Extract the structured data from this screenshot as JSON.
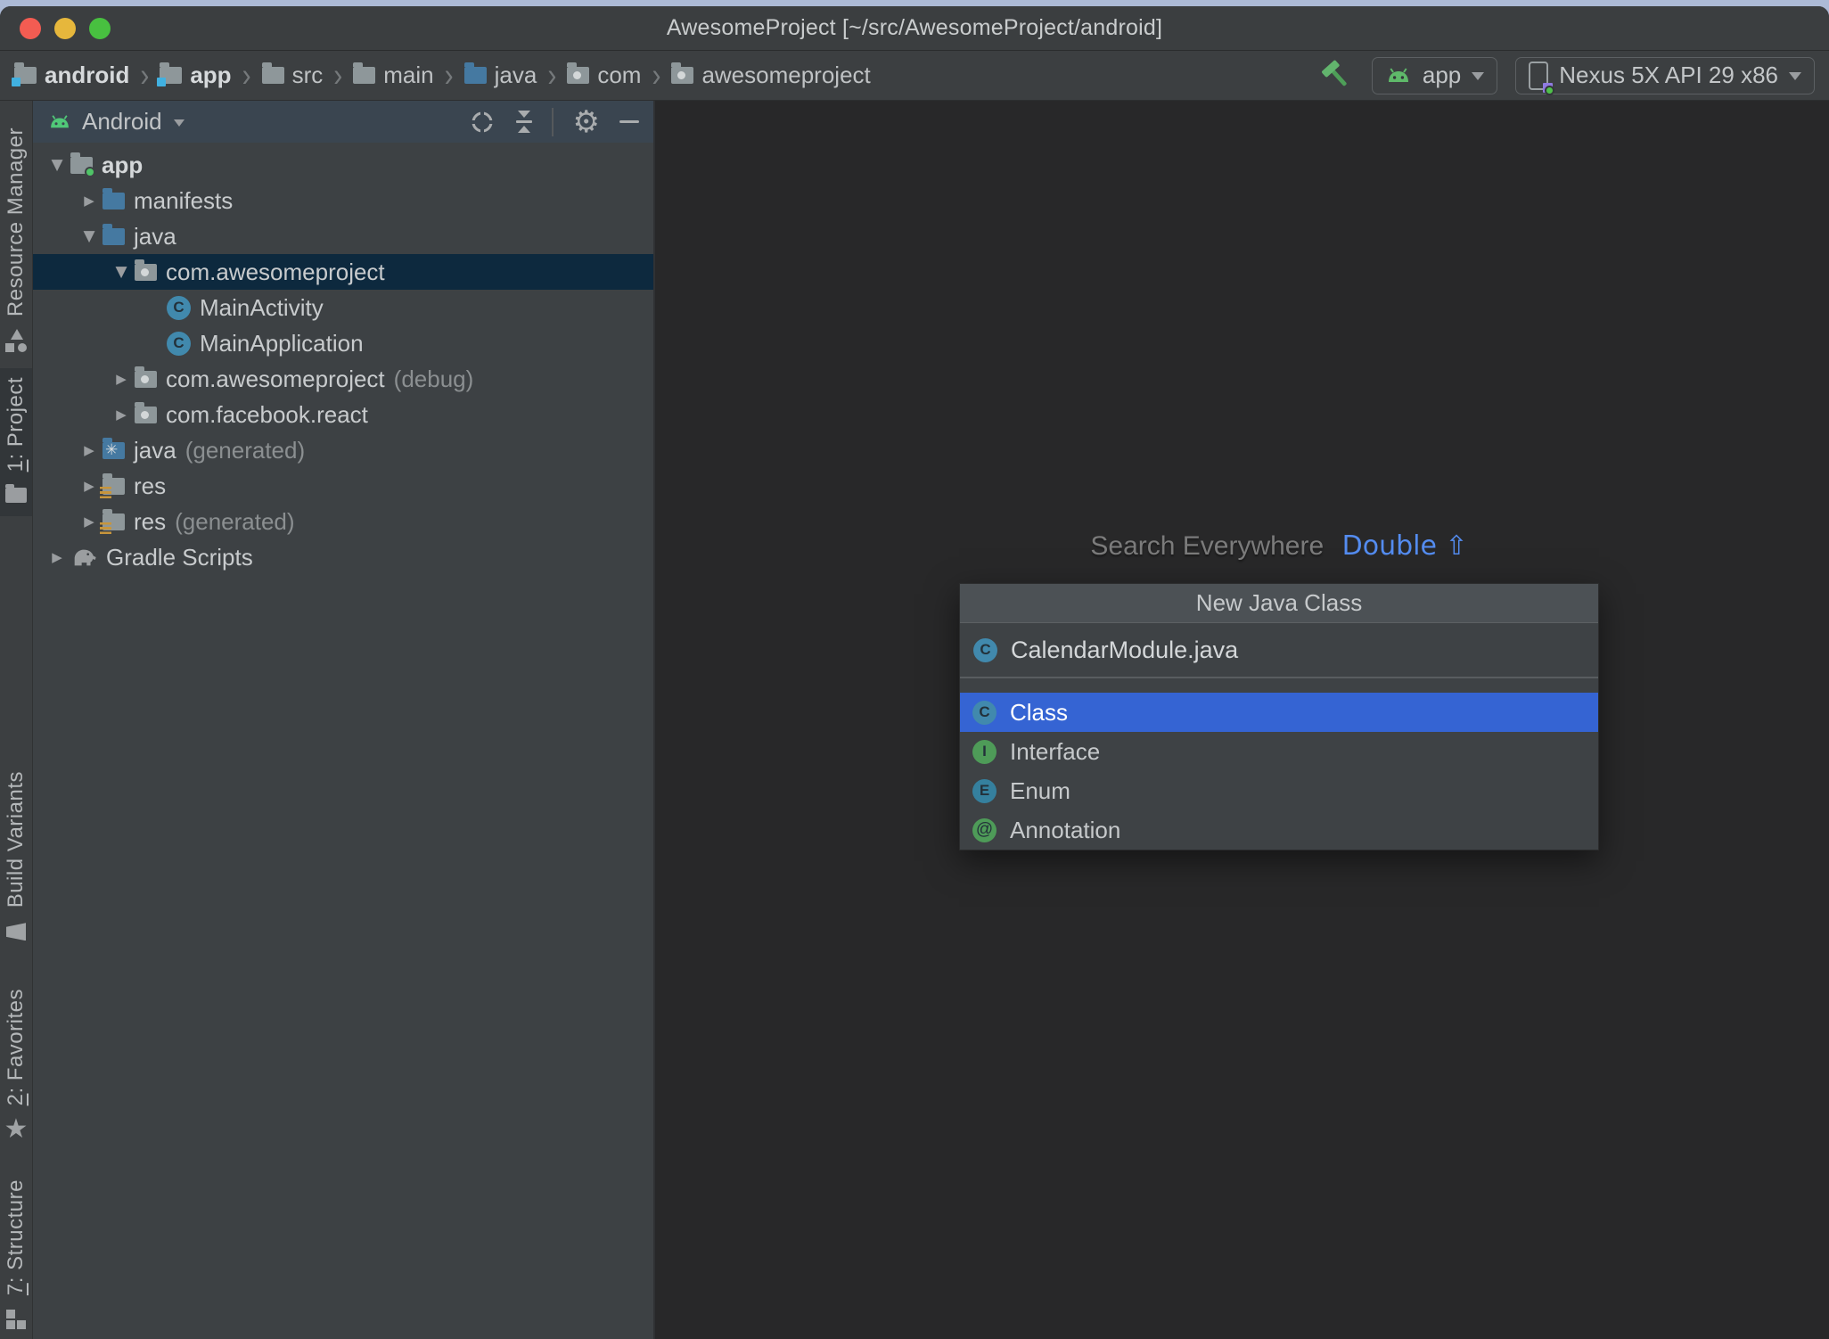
{
  "window": {
    "title": "AwesomeProject [~/src/AwesomeProject/android]"
  },
  "toolbar": {
    "breadcrumbs": [
      {
        "label": "android",
        "icon": "module-folder"
      },
      {
        "label": "app",
        "icon": "module-folder"
      },
      {
        "label": "src",
        "icon": "folder"
      },
      {
        "label": "main",
        "icon": "folder"
      },
      {
        "label": "java",
        "icon": "source-folder"
      },
      {
        "label": "com",
        "icon": "package-folder"
      },
      {
        "label": "awesomeproject",
        "icon": "package-folder"
      }
    ],
    "build_icon": "hammer",
    "run_config": {
      "label": "app",
      "icon": "android-head"
    },
    "device": {
      "label": "Nexus 5X API 29 x86",
      "icon": "device-phone"
    }
  },
  "tool_strip": {
    "items": [
      {
        "mnemonic": "",
        "label": "Resource Manager",
        "icon": "shapes",
        "active": false
      },
      {
        "mnemonic": "1",
        "label": ": Project",
        "icon": "folder",
        "active": true
      },
      {
        "mnemonic": "",
        "label": "Build Variants",
        "icon": "variants",
        "active": false
      },
      {
        "mnemonic": "2",
        "label": ": Favorites",
        "icon": "star",
        "active": false
      },
      {
        "mnemonic": "7",
        "label": ": Structure",
        "icon": "structure",
        "active": false
      }
    ]
  },
  "project_panel": {
    "view_selector": "Android",
    "header_icons": [
      "locate",
      "collapse-all",
      "settings-gear",
      "hide"
    ],
    "tree": [
      {
        "label": "app",
        "suffix": "",
        "level": 0,
        "state": "expanded",
        "icon": "module-folder-green-dot",
        "selected": false
      },
      {
        "label": "manifests",
        "suffix": "",
        "level": 1,
        "state": "collapsed",
        "icon": "source-folder",
        "selected": false
      },
      {
        "label": "java",
        "suffix": "",
        "level": 1,
        "state": "expanded",
        "icon": "source-folder",
        "selected": false
      },
      {
        "label": "com.awesomeproject",
        "suffix": "",
        "level": 2,
        "state": "expanded",
        "icon": "package-folder",
        "selected": true
      },
      {
        "label": "MainActivity",
        "suffix": "",
        "level": 3,
        "state": "leaf",
        "icon": "java-class",
        "selected": false
      },
      {
        "label": "MainApplication",
        "suffix": "",
        "level": 3,
        "state": "leaf",
        "icon": "java-class",
        "selected": false
      },
      {
        "label": "com.awesomeproject",
        "suffix": "(debug)",
        "level": 2,
        "state": "collapsed",
        "icon": "package-folder",
        "selected": false
      },
      {
        "label": "com.facebook.react",
        "suffix": "",
        "level": 2,
        "state": "collapsed",
        "icon": "package-folder",
        "selected": false
      },
      {
        "label": "java",
        "suffix": "(generated)",
        "level": 1,
        "state": "collapsed",
        "icon": "generated-source-folder",
        "selected": false
      },
      {
        "label": "res",
        "suffix": "",
        "level": 1,
        "state": "collapsed",
        "icon": "res-folder",
        "selected": false
      },
      {
        "label": "res",
        "suffix": "(generated)",
        "level": 1,
        "state": "collapsed",
        "icon": "res-folder",
        "selected": false
      },
      {
        "label": "Gradle Scripts",
        "suffix": "",
        "level": 0,
        "state": "collapsed",
        "icon": "gradle-elephant",
        "selected": false
      }
    ]
  },
  "editor": {
    "hint_text": "Search Everywhere",
    "hint_shortcut": "Double ⇧"
  },
  "popup": {
    "title": "New Java Class",
    "input_value": "CalendarModule.java",
    "input_icon": "class-icon",
    "items": [
      {
        "label": "Class",
        "icon": "class-icon",
        "selected": true
      },
      {
        "label": "Interface",
        "icon": "interface-icon",
        "selected": false
      },
      {
        "label": "Enum",
        "icon": "enum-icon",
        "selected": false
      },
      {
        "label": "Annotation",
        "icon": "annotation-icon",
        "selected": false
      }
    ]
  },
  "colors": {
    "selection_blue": "#3564d3",
    "tree_selection": "#0d293e",
    "accent_green": "#5fb96a",
    "hint_link_blue": "#548cf0",
    "panel_bg": "#3d4144",
    "editor_bg": "#282829"
  }
}
